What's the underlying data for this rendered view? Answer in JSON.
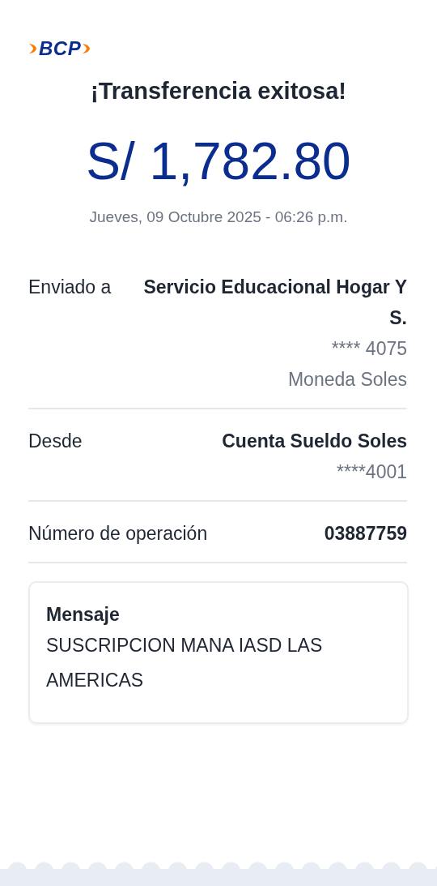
{
  "logo": {
    "text": "BCP"
  },
  "title": "¡Transferencia exitosa!",
  "amount": "S/ 1,782.80",
  "datetime": "Jueves, 09 Octubre 2025 - 06:26 p.m.",
  "details": [
    {
      "label": "Enviado a",
      "lines": [
        {
          "text": "Servicio Educacional Hogar Y S.",
          "kind": "strong"
        },
        {
          "text": "**** 4075",
          "kind": "muted"
        },
        {
          "text": "Moneda Soles",
          "kind": "muted"
        }
      ]
    },
    {
      "label": "Desde",
      "lines": [
        {
          "text": "Cuenta Sueldo Soles",
          "kind": "strong"
        },
        {
          "text": "****4001",
          "kind": "muted"
        }
      ]
    },
    {
      "label": "Número de operación",
      "lines": [
        {
          "text": "03887759",
          "kind": "strong"
        }
      ]
    }
  ],
  "message": {
    "heading": "Mensaje",
    "text": "SUSCRIPCION MANA IASD LAS AMERICAS"
  }
}
